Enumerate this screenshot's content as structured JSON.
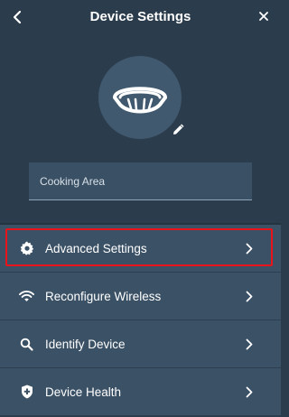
{
  "header": {
    "title": "Device Settings",
    "back_icon": "chevron-left-icon",
    "close_icon": "close-icon"
  },
  "device": {
    "image_icon": "smoke-detector-icon",
    "edit_icon": "pencil-icon",
    "name_value": "Cooking Area"
  },
  "menu": {
    "items": [
      {
        "label": "Advanced Settings",
        "icon": "gear-icon",
        "highlighted": true
      },
      {
        "label": "Reconfigure Wireless",
        "icon": "wifi-icon",
        "highlighted": false
      },
      {
        "label": "Identify Device",
        "icon": "search-icon",
        "highlighted": false
      },
      {
        "label": "Device Health",
        "icon": "shield-plus-icon",
        "highlighted": false
      }
    ],
    "chevron_icon": "chevron-right-icon"
  },
  "colors": {
    "background": "#2b3c4c",
    "menu_item": "#3b5166",
    "avatar": "#40596f",
    "highlight_border": "#e8141a"
  }
}
